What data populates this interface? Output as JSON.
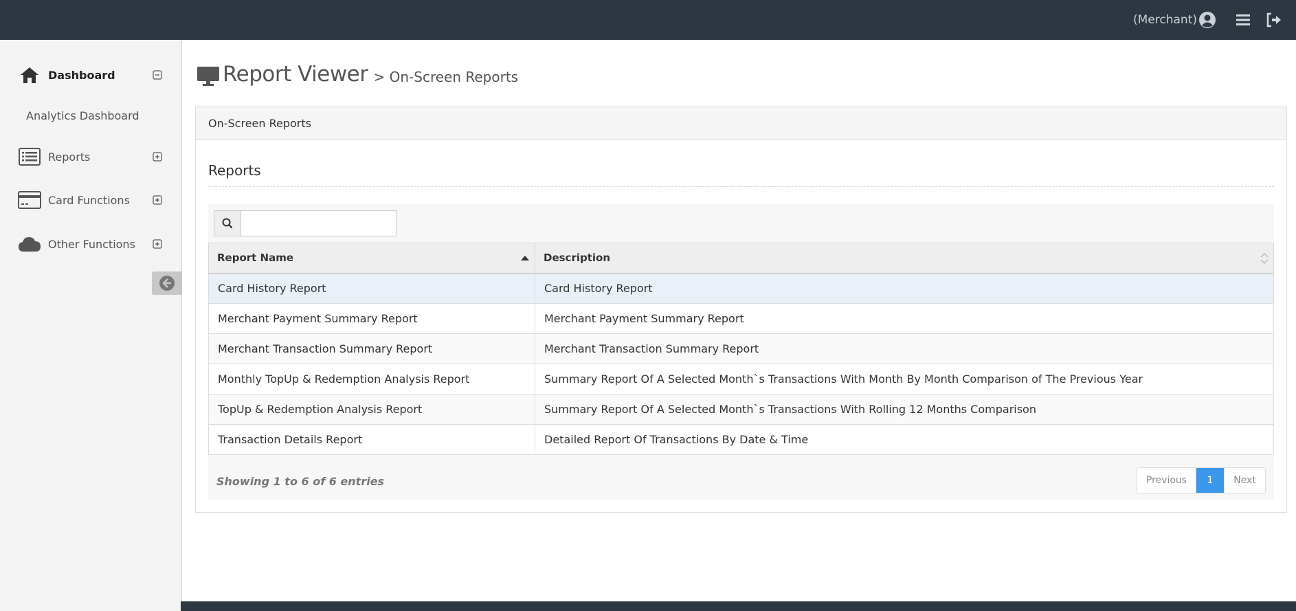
{
  "topbar": {
    "user_label": "(Merchant)",
    "icons": [
      "user-circle-icon",
      "menu-icon",
      "logout-icon"
    ]
  },
  "sidebar": {
    "items": [
      {
        "label": "Dashboard",
        "icon": "home-icon",
        "state": "expanded"
      },
      {
        "label": "Analytics Dashboard"
      },
      {
        "label": "Reports",
        "icon": "list-icon",
        "state": "collapsed"
      },
      {
        "label": "Card Functions",
        "icon": "credit-card-icon",
        "state": "collapsed"
      },
      {
        "label": "Other Functions",
        "icon": "cloud-icon",
        "state": "collapsed"
      }
    ],
    "collapse_icon": "arrow-left-circle-icon"
  },
  "header": {
    "icon": "monitor-icon",
    "title": "Report Viewer",
    "breadcrumb": "> On-Screen Reports"
  },
  "panel": {
    "heading": "On-Screen Reports",
    "section_title": "Reports",
    "search": {
      "value": "",
      "placeholder": ""
    },
    "columns": [
      "Report Name",
      "Description"
    ],
    "rows": [
      [
        "Card History Report",
        "Card History Report"
      ],
      [
        "Merchant Payment Summary Report",
        "Merchant Payment Summary Report"
      ],
      [
        "Merchant Transaction Summary Report",
        "Merchant Transaction Summary Report"
      ],
      [
        "Monthly TopUp & Redemption Analysis Report",
        "Summary Report Of A Selected Month`s Transactions With Month By Month Comparison of The Previous Year"
      ],
      [
        "TopUp & Redemption Analysis Report",
        "Summary Report Of A Selected Month`s Transactions With Rolling 12 Months Comparison"
      ],
      [
        "Transaction Details Report",
        "Detailed Report Of Transactions By Date & Time"
      ]
    ],
    "info": "Showing 1 to 6 of 6 entries",
    "pager": {
      "previous": "Previous",
      "current": "1",
      "next": "Next"
    }
  },
  "colors": {
    "topbar": "#2d3741",
    "sidebar": "#f3f3f3",
    "pager_active": "#3b97ec"
  }
}
